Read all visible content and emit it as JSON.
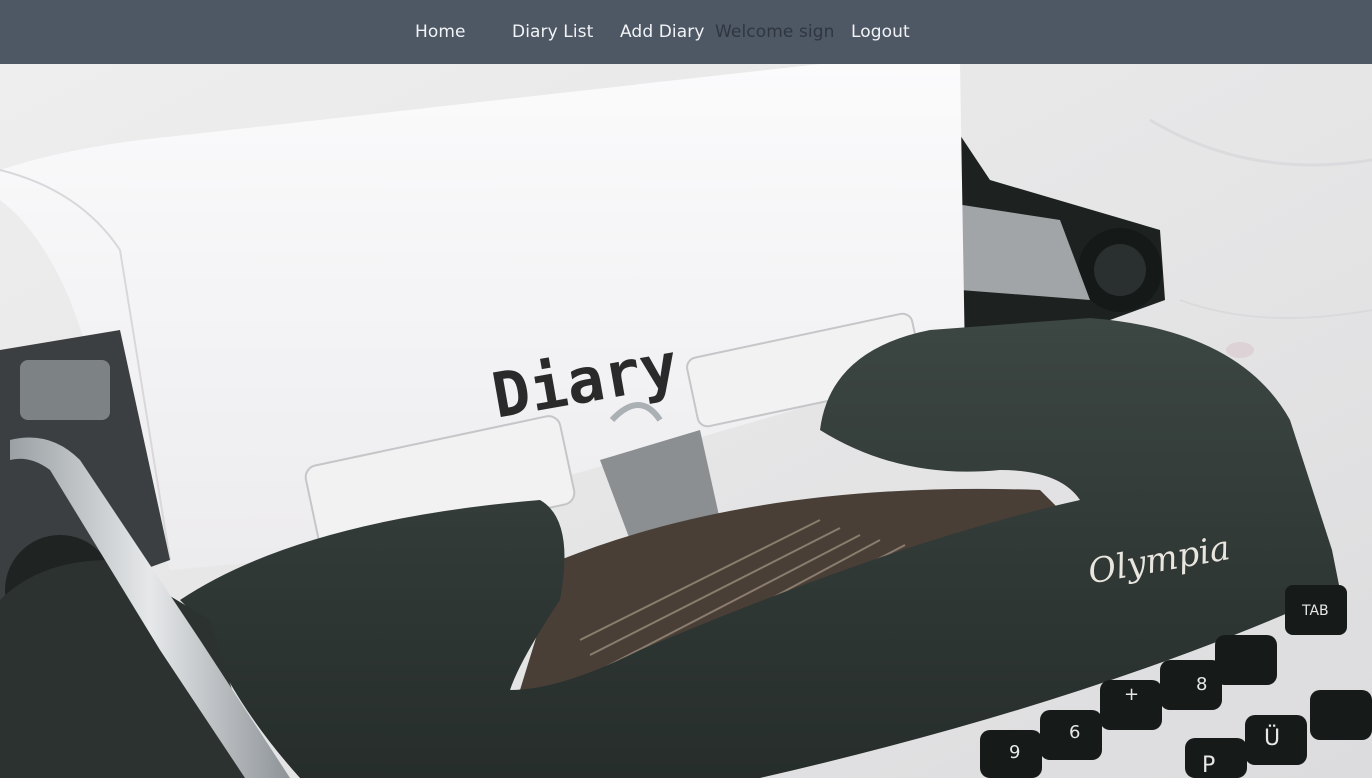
{
  "nav": {
    "home": "Home",
    "diary_list": "Diary List",
    "add_diary": "Add Diary",
    "welcome": "Welcome sign",
    "logout": "Logout"
  },
  "hero": {
    "paper_text": "Diary",
    "brand_text": "Olympia",
    "key_labels": [
      "TAB",
      "8",
      "Ü",
      "P",
      "6",
      "+",
      "9"
    ]
  }
}
